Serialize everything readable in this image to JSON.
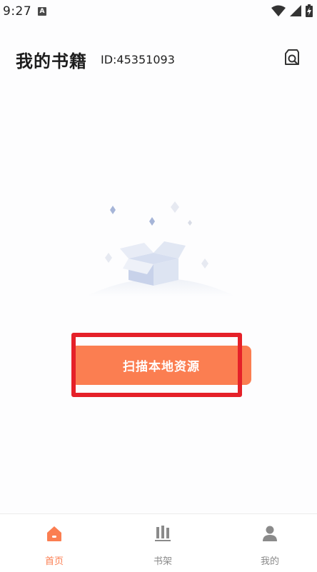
{
  "status_bar": {
    "time": "9:27",
    "notification_badge": "A"
  },
  "header": {
    "title": "我的书籍",
    "user_id": "ID:45351093"
  },
  "main": {
    "scan_button_label": "扫描本地资源"
  },
  "bottom_nav": {
    "items": [
      {
        "label": "首页",
        "icon": "home-icon",
        "active": true
      },
      {
        "label": "书架",
        "icon": "bookshelf-icon",
        "active": false
      },
      {
        "label": "我的",
        "icon": "profile-icon",
        "active": false
      }
    ]
  },
  "colors": {
    "accent": "#fb7e51",
    "highlight": "#e52129",
    "inactive": "#8a8a8a"
  }
}
